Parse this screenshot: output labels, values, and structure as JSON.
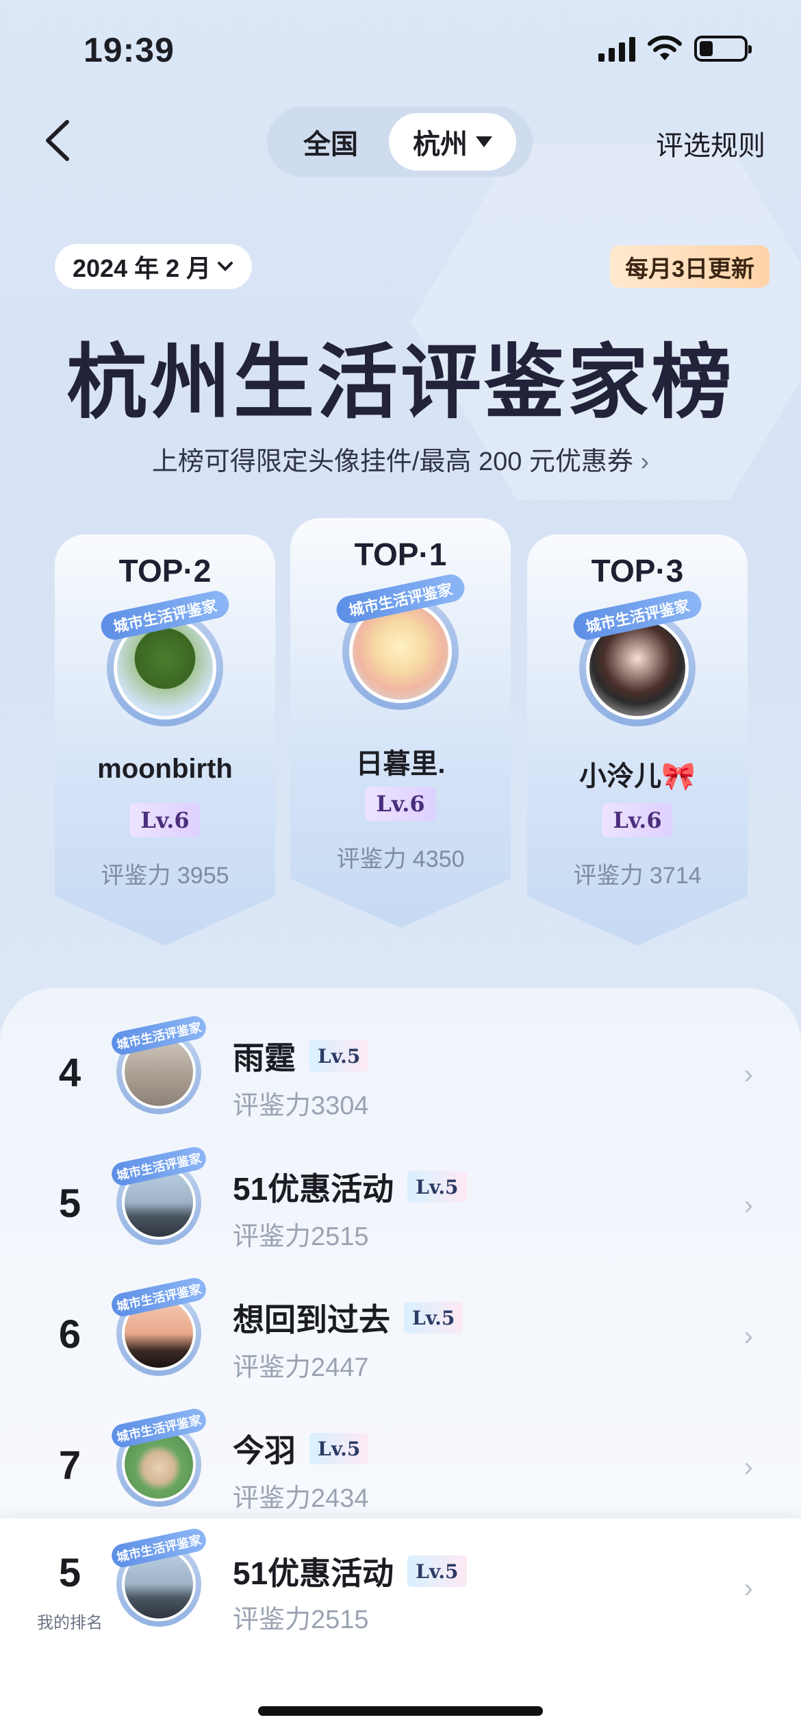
{
  "status_bar": {
    "time": "19:39",
    "battery_level": 0.3
  },
  "header": {
    "region_tabs": [
      "全国",
      "杭州"
    ],
    "selected_region": "杭州",
    "rules_link": "评选规则"
  },
  "period": {
    "date_label": "2024 年 2 月",
    "update_note": "每月3日更新"
  },
  "title": "杭州生活评鉴家榜",
  "subtitle": "上榜可得限定头像挂件/最高 200 元优惠券",
  "ring_tag": "城市生活评鉴家",
  "podium": [
    {
      "rank_label": "TOP·2",
      "name": "moonbirth",
      "level": "Lv.6",
      "score": "评鉴力 3955",
      "avatar": "tree-photo"
    },
    {
      "rank_label": "TOP·1",
      "name": "日暮里.",
      "level": "Lv.6",
      "score": "评鉴力 4350",
      "avatar": "anime-girl"
    },
    {
      "rank_label": "TOP·3",
      "name": "小泠儿🎀",
      "level": "Lv.6",
      "score": "评鉴力 3714",
      "avatar": "cartoon-girl"
    }
  ],
  "list": [
    {
      "rank": "4",
      "name": "雨霆",
      "level": "Lv.5",
      "score": "评鉴力3304",
      "avatar": "room-photo"
    },
    {
      "rank": "5",
      "name": "51优惠活动",
      "level": "Lv.5",
      "score": "评鉴力2515",
      "avatar": "city-photo"
    },
    {
      "rank": "6",
      "name": "想回到过去",
      "level": "Lv.5",
      "score": "评鉴力2447",
      "avatar": "sunset-photo"
    },
    {
      "rank": "7",
      "name": "今羽",
      "level": "Lv.5",
      "score": "评鉴力2434",
      "avatar": "cartoon-avatar"
    }
  ],
  "my_rank": {
    "rank": "5",
    "label": "我的排名",
    "name": "51优惠活动",
    "level": "Lv.5",
    "score": "评鉴力2515",
    "avatar": "city-photo"
  },
  "colors": {
    "accent_blue": "#5c8ee6",
    "level_purple": "#4a2e7c",
    "update_badge": "#ffd3a8"
  }
}
